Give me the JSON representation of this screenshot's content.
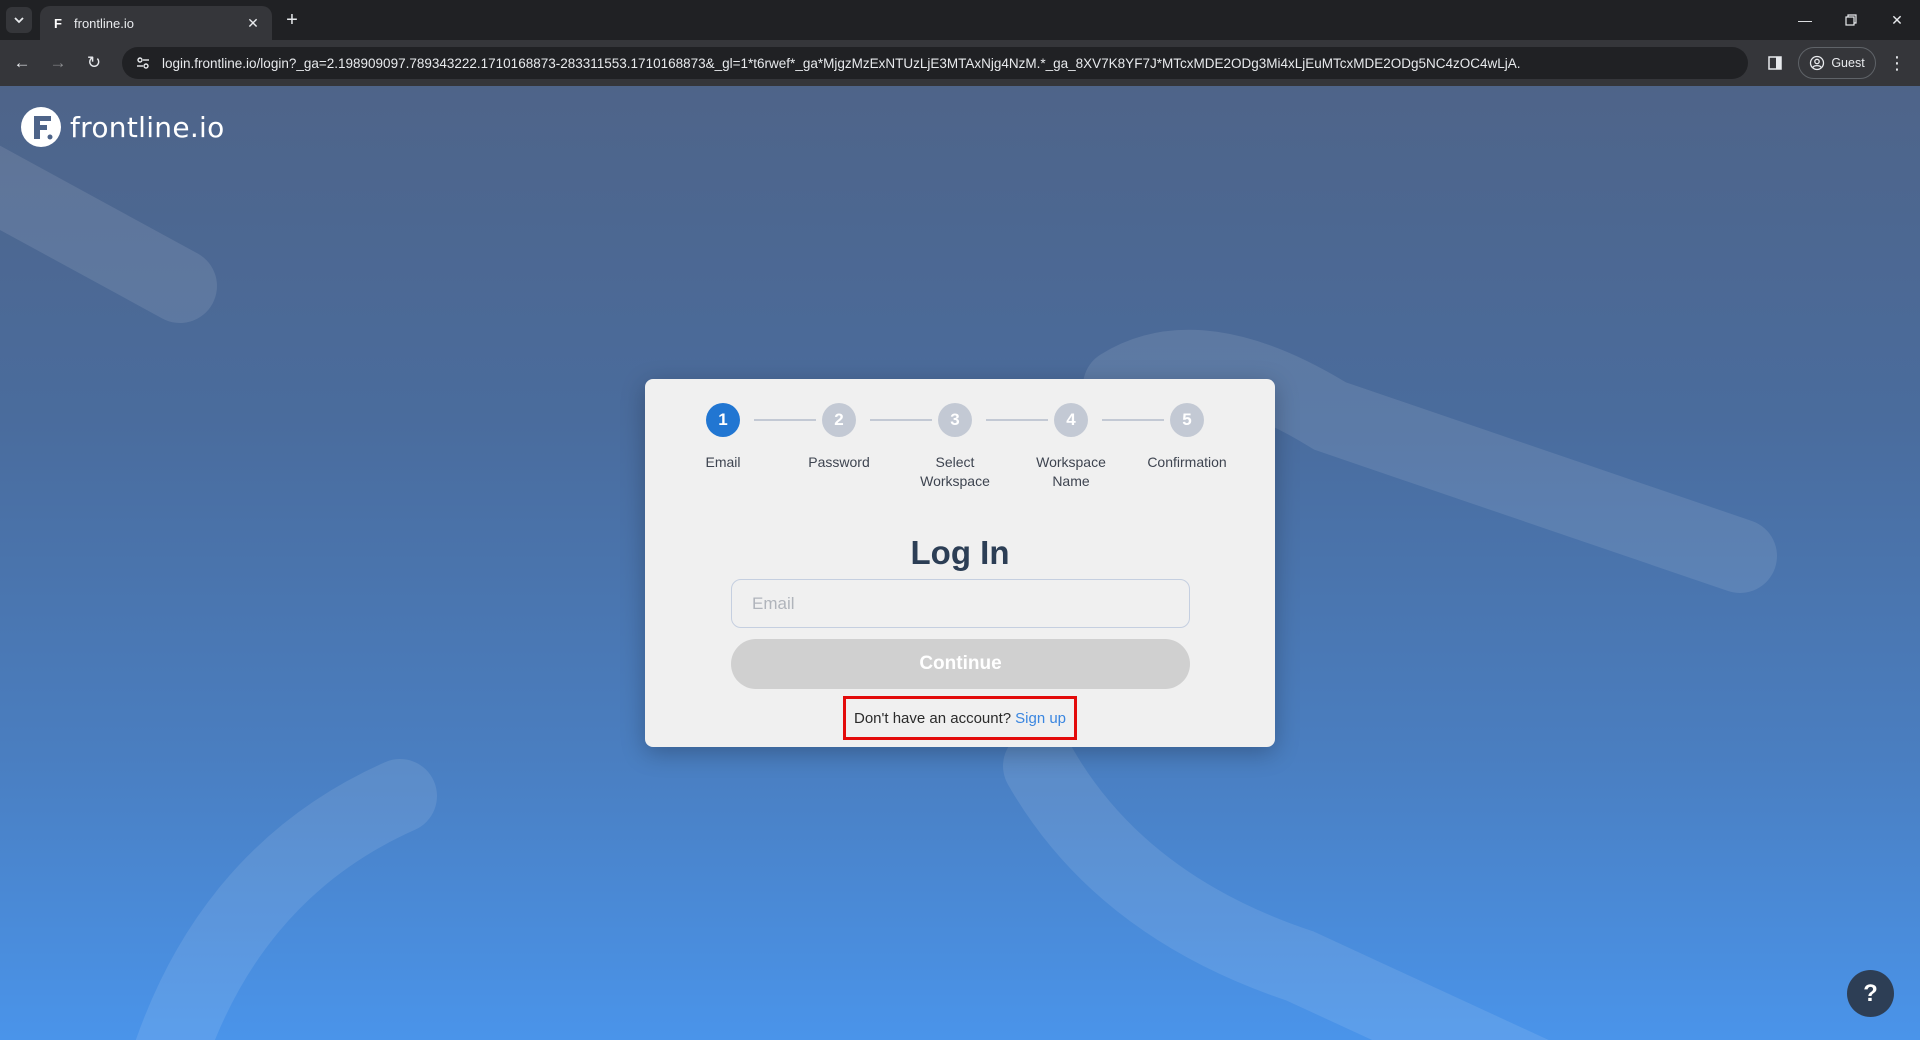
{
  "browser": {
    "tab_title": "frontline.io",
    "tab_favicon": "F",
    "url": "login.frontline.io/login?_ga=2.198909097.789343222.1710168873-283311553.1710168873&_gl=1*t6rwef*_ga*MjgzMzExNTUzLjE3MTAxNjg4NzM.*_ga_8XV7K8YF7J*MTcxMDE2ODg3Mi4xLjEuMTcxMDE2ODg5NC4zOC4wLjA.",
    "profile_label": "Guest"
  },
  "brand": {
    "logo_text": "frontline.io"
  },
  "steps": [
    {
      "number": "1",
      "label": "Email",
      "active": true
    },
    {
      "number": "2",
      "label": "Password",
      "active": false
    },
    {
      "number": "3",
      "label": "Select Workspace",
      "active": false
    },
    {
      "number": "4",
      "label": "Workspace Name",
      "active": false
    },
    {
      "number": "5",
      "label": "Confirmation",
      "active": false
    }
  ],
  "login": {
    "heading": "Log In",
    "email_placeholder": "Email",
    "email_value": "",
    "continue_label": "Continue",
    "signup_prompt": "Don't have an account?",
    "signup_link": "Sign up"
  },
  "help": {
    "label": "?"
  },
  "colors": {
    "accent": "#2176d2",
    "step_inactive": "#c3c9d4",
    "link": "#3a86e0",
    "highlight_box": "#e30b0b"
  }
}
